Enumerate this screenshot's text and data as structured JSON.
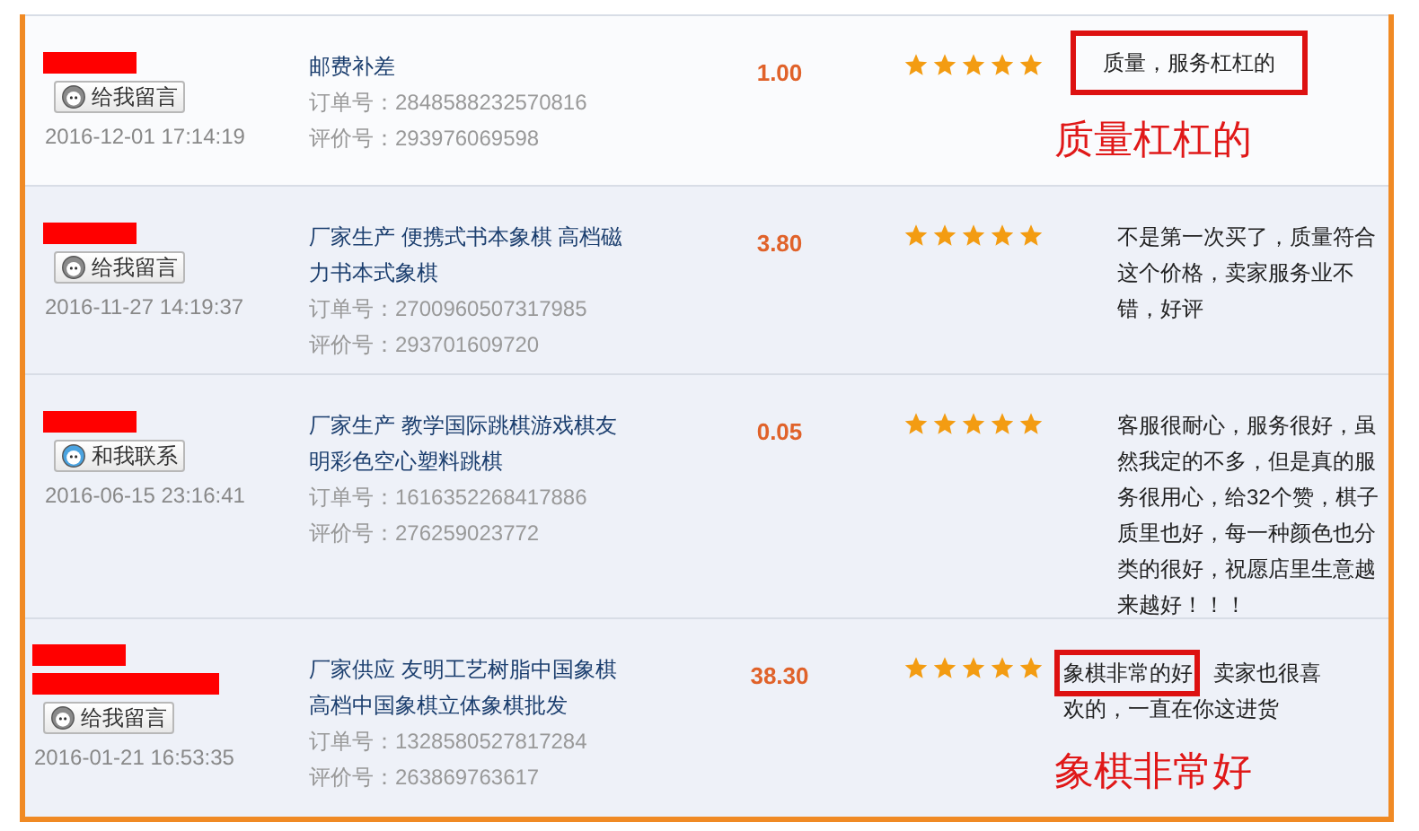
{
  "reviews": [
    {
      "redaction_bars": [
        {
          "kind": "short"
        }
      ],
      "contact_button": {
        "kind": "message",
        "label": "给我留言"
      },
      "time": "2016-12-01 17:14:19",
      "product": "邮费补差",
      "order_no": "订单号：2848588232570816",
      "review_no": "评价号：293976069598",
      "price": "1.00",
      "stars": 5,
      "comment": "质量，服务杠杠的",
      "comment_box": {
        "kind": "full"
      },
      "annotation": "质量杠杠的"
    },
    {
      "redaction_bars": [
        {
          "kind": "short"
        }
      ],
      "contact_button": {
        "kind": "message",
        "label": "给我留言"
      },
      "time": "2016-11-27 14:19:37",
      "product": "厂家生产 便携式书本象棋 高档磁力书本式象棋",
      "order_no": "订单号：2700960507317985",
      "review_no": "评价号：293701609720",
      "price": "3.80",
      "stars": 5,
      "comment": "不是第一次买了，质量符合这个价格，卖家服务业不错，好评"
    },
    {
      "redaction_bars": [
        {
          "kind": "short"
        }
      ],
      "contact_button": {
        "kind": "contact",
        "label": "和我联系"
      },
      "time": "2016-06-15 23:16:41",
      "product": "厂家生产 教学国际跳棋游戏棋友明彩色空心塑料跳棋",
      "order_no": "订单号：1616352268417886",
      "review_no": "评价号：276259023772",
      "price": "0.05",
      "stars": 5,
      "comment": "客服很耐心，服务很好，虽然我定的不多，但是真的服务很用心，给32个赞，棋子质里也好，每一种颜色也分类的很好，祝愿店里生意越来越好！！！"
    },
    {
      "redaction_bars": [
        {
          "kind": "short"
        },
        {
          "kind": "long"
        }
      ],
      "contact_button": {
        "kind": "message",
        "label": "给我留言"
      },
      "time": "2016-01-21 16:53:35",
      "product": "厂家供应 友明工艺树脂中国象棋高档中国象棋立体象棋批发",
      "order_no": "订单号：1328580527817284",
      "review_no": "评价号：263869763617",
      "price": "38.30",
      "stars": 5,
      "comment": "象棋非常的好 卖家也很喜欢的，一直在你这进货",
      "comment_box": {
        "kind": "partial"
      },
      "annotation": "象棋非常好"
    }
  ]
}
